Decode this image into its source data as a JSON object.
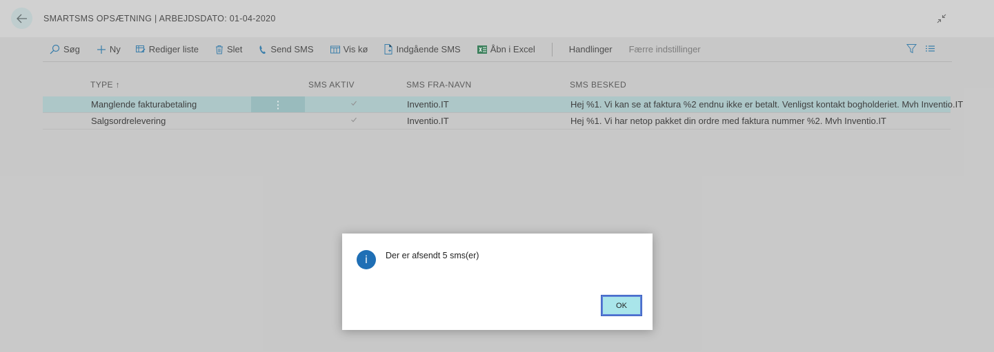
{
  "header": {
    "title": "SMARTSMS OPSÆTNING | ARBEJDSDATO: 01-04-2020"
  },
  "toolbar": {
    "search": "Søg",
    "new": "Ny",
    "edit_list": "Rediger liste",
    "delete": "Slet",
    "send_sms": "Send SMS",
    "show_queue": "Vis kø",
    "incoming_sms": "Indgående SMS",
    "open_excel": "Åbn i Excel",
    "actions": "Handlinger",
    "fewer_settings": "Færre indstillinger"
  },
  "table": {
    "columns": [
      "TYPE ↑",
      "SMS AKTIV",
      "SMS FRA-NAVN",
      "SMS BESKED"
    ],
    "rows": [
      {
        "type": "Manglende fakturabetaling",
        "active": true,
        "from_name": "Inventio.IT",
        "message": "Hej %1. Vi kan se at faktura %2 endnu ikke er betalt. Venligst kontakt bogholderiet. Mvh Inventio.IT",
        "selected": true
      },
      {
        "type": "Salgsordrelevering",
        "active": true,
        "from_name": "Inventio.IT",
        "message": "Hej %1. Vi har netop pakket din ordre med faktura nummer %2. Mvh Inventio.IT",
        "selected": false
      }
    ]
  },
  "dialog": {
    "icon": "i",
    "message": "Der er afsendt 5 sms(er)",
    "ok_label": "OK"
  },
  "colors": {
    "selected_row": "#a8c7c9",
    "info_icon": "#1f6fb5",
    "ok_button": "#a9e5ea"
  }
}
